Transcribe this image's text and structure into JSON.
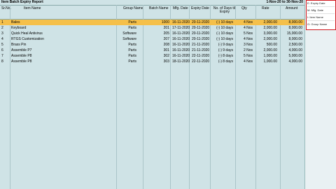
{
  "report": {
    "title": "Item Batch Expiry Report",
    "period": "1-Nov-20 to 30-Nov-20"
  },
  "columns": {
    "sr_no": "Sr.No.",
    "item_name": "Item Name",
    "group_name": "Group Name",
    "batch_name": "Batch Name",
    "mfg_date": "Mfg. Date",
    "expiry_date": "Expiry Date",
    "days_till_expiry_line1": "No. of Days till",
    "days_till_expiry_line2": "Expiry",
    "qty": "Qty",
    "rate": "Rate",
    "amount": "Amount"
  },
  "rows": [
    {
      "sr": "1",
      "item": "Bales",
      "group": "Parts",
      "batch": "1000",
      "mfg": "16-11-2020",
      "expiry": "20-11-2020",
      "days": "(-) 10 days",
      "qty": "4 Nos",
      "rate": "2,000.00",
      "amount": "8,000.00"
    },
    {
      "sr": "2",
      "item": "Keyboard",
      "group": "Parts",
      "batch": "201",
      "mfg": "17-11-2020",
      "expiry": "20-11-2020",
      "days": "(-) 10 days",
      "qty": "4 Nos",
      "rate": "2,000.00",
      "amount": "8,000.00"
    },
    {
      "sr": "3",
      "item": "Quick Heal Antivirus",
      "group": "Software",
      "batch": "205",
      "mfg": "16-11-2020",
      "expiry": "20-11-2020",
      "days": "(-) 10 days",
      "qty": "5 Nos",
      "rate": "3,000.00",
      "amount": "15,000.00"
    },
    {
      "sr": "4",
      "item": "RTGS Customization",
      "group": "Software",
      "batch": "207",
      "mfg": "16-11-2020",
      "expiry": "20-11-2020",
      "days": "(-) 10 days",
      "qty": "4 Nos",
      "rate": "2,000.00",
      "amount": "8,000.00"
    },
    {
      "sr": "5",
      "item": "Brass Pin",
      "group": "Parts",
      "batch": "208",
      "mfg": "16-11-2020",
      "expiry": "21-11-2020",
      "days": "(-) 9 days",
      "qty": "3 Nos",
      "rate": "500.00",
      "amount": "2,500.00"
    },
    {
      "sr": "6",
      "item": "Assemble P7",
      "group": "Parts",
      "batch": "301",
      "mfg": "16-11-2020",
      "expiry": "21-11-2020",
      "days": "(-) 9 days",
      "qty": "2 Nos",
      "rate": "2,000.00",
      "amount": "4,000.00"
    },
    {
      "sr": "7",
      "item": "Assemble P8",
      "group": "Parts",
      "batch": "302",
      "mfg": "16-11-2020",
      "expiry": "22-11-2020",
      "days": "(-) 8 days",
      "qty": "5 Nos",
      "rate": "1,000.00",
      "amount": "5,000.00"
    },
    {
      "sr": "8",
      "item": "Assemble P8",
      "group": "Parts",
      "batch": "303",
      "mfg": "18-11-2020",
      "expiry": "22-11-2020",
      "days": "(-) 8 days",
      "qty": "4 Nos",
      "rate": "1,000.00",
      "amount": "4,000.00"
    }
  ],
  "options": [
    {
      "key": "E",
      "label": "Expiry Date"
    },
    {
      "key": "M",
      "label": "Mfg. Date"
    },
    {
      "key": "I",
      "label": "Item Name"
    },
    {
      "key": "G",
      "label": "Group Name"
    }
  ],
  "colors": {
    "background": "#cfe3e6",
    "selected_row": "#f5c04a",
    "options_border": "#d0161d"
  }
}
